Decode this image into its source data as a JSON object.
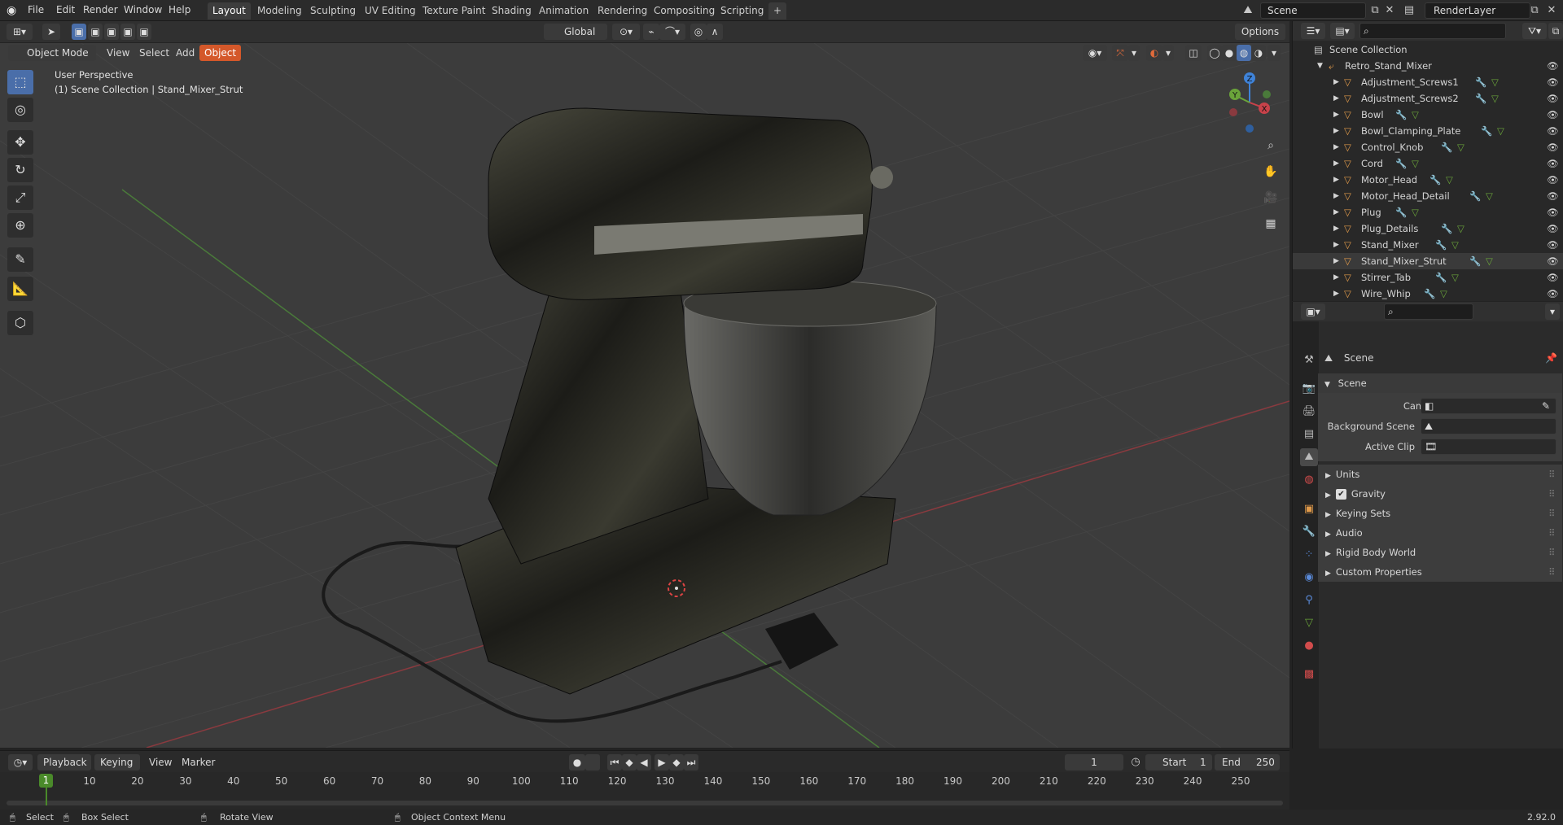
{
  "app": {
    "version": "2.92.0",
    "logo": "blender-logo"
  },
  "topbar": {
    "menus": [
      "File",
      "Edit",
      "Render",
      "Window",
      "Help"
    ],
    "workspaces": [
      "Layout",
      "Modeling",
      "Sculpting",
      "UV Editing",
      "Texture Paint",
      "Shading",
      "Animation",
      "Rendering",
      "Compositing",
      "Scripting"
    ],
    "active_workspace": "Layout",
    "add_workspace": "+",
    "scene": "Scene",
    "view_layer": "RenderLayer"
  },
  "viewport_header": {
    "mode": "Object Mode",
    "menus": [
      "View",
      "Select",
      "Add",
      "Object"
    ],
    "active_menu": "Object",
    "orientation": "Global",
    "options": "Options"
  },
  "viewport": {
    "perspective_label": "User Perspective",
    "collection_label": "(1) Scene Collection | Stand_Mixer_Strut",
    "gizmo_axes": [
      "X",
      "Y",
      "Z"
    ],
    "colors": {
      "x_axis": "#c8424a",
      "y_axis": "#6aa43a",
      "z_axis": "#3f83d9",
      "active_menu": "#d4582a",
      "active_tool": "#4a6ea9"
    }
  },
  "outliner": {
    "root": "Scene Collection",
    "collection": "Retro_Stand_Mixer",
    "objects": [
      "Adjustment_Screws1",
      "Adjustment_Screws2",
      "Bowl",
      "Bowl_Clamping_Plate",
      "Control_Knob",
      "Cord",
      "Motor_Head",
      "Motor_Head_Detail",
      "Plug",
      "Plug_Details",
      "Stand_Mixer",
      "Stand_Mixer_Strut",
      "Stirrer_Tab",
      "Wire_Whip"
    ],
    "selected": "Stand_Mixer_Strut"
  },
  "properties": {
    "context": "Scene",
    "panel_title": "Scene",
    "fields": {
      "camera": "Camera",
      "background_scene": "Background Scene",
      "active_clip": "Active Clip"
    },
    "subpanels": [
      "Units",
      "Gravity",
      "Keying Sets",
      "Audio",
      "Rigid Body World",
      "Custom Properties"
    ],
    "gravity_checked": true
  },
  "timeline": {
    "menus": [
      "Playback",
      "Keying",
      "View",
      "Marker"
    ],
    "current_frame": "1",
    "start_label": "Start",
    "start": "1",
    "end_label": "End",
    "end": "250",
    "ticks": [
      "1",
      "10",
      "20",
      "30",
      "40",
      "50",
      "60",
      "70",
      "80",
      "90",
      "100",
      "110",
      "120",
      "130",
      "140",
      "150",
      "160",
      "170",
      "180",
      "190",
      "200",
      "210",
      "220",
      "230",
      "240",
      "250"
    ]
  },
  "statusbar": {
    "select": "Select",
    "box_select": "Box Select",
    "rotate_view": "Rotate View",
    "context_menu": "Object Context Menu",
    "version": "2.92.0"
  }
}
